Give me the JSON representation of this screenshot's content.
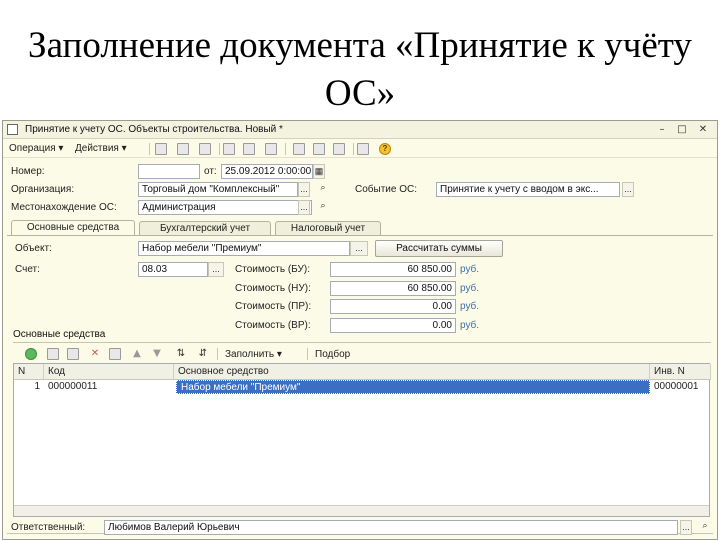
{
  "slide": {
    "title": "Заполнение документа «Принятие к учёту ОС»"
  },
  "window": {
    "title": "Принятие к учету ОС. Объекты строительства. Новый *",
    "controls": {
      "minimize": "–",
      "maximize": "□",
      "close": "✕"
    }
  },
  "toolbar": {
    "operation": "Операция",
    "actions": "Действия"
  },
  "header": {
    "number_label": "Номер:",
    "number_value": "",
    "date_label": "от:",
    "date_value": "25.09.2012 0:00:00",
    "org_label": "Организация:",
    "org_value": "Торговый дом \"Комплексный\"",
    "event_label": "Событие ОС:",
    "event_value": "Принятие к учету с вводом в экс...",
    "location_label": "Местонахождение ОС:",
    "location_value": "Администрация"
  },
  "tabs": [
    "Основные средства",
    "Бухгалтерский учет",
    "Налоговый учет"
  ],
  "main": {
    "object_label": "Объект:",
    "object_value": "Набор мебели \"Премиум\"",
    "calc_button": "Рассчитать суммы",
    "account_label": "Счет:",
    "account_value": "08.03",
    "costs": [
      {
        "label": "Стоимость (БУ):",
        "value": "60 850.00",
        "currency": "руб."
      },
      {
        "label": "Стоимость (НУ):",
        "value": "60 850.00",
        "currency": "руб."
      },
      {
        "label": "Стоимость (ПР):",
        "value": "0.00",
        "currency": "руб."
      },
      {
        "label": "Стоимость (ВР):",
        "value": "0.00",
        "currency": "руб."
      }
    ]
  },
  "section": {
    "title": "Основные средства",
    "fill_label": "Заполнить",
    "select_label": "Подбор"
  },
  "table": {
    "columns": [
      "N",
      "Код",
      "Основное средство",
      "Инв. N"
    ],
    "rows": [
      {
        "n": "1",
        "code": "000000011",
        "asset": "Набор мебели \"Премиум\"",
        "inv": "00000001"
      }
    ]
  },
  "footer": {
    "responsible_label": "Ответственный:",
    "responsible_value": "Любимов Валерий Юрьевич"
  }
}
